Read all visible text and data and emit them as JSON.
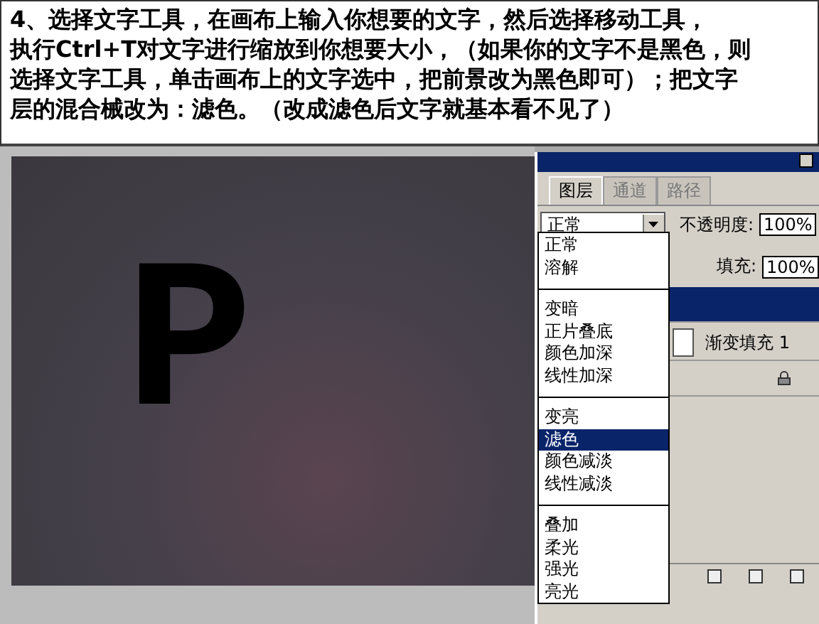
{
  "instructions": {
    "lines": [
      "4、选择文字工具，在画布上输入你想要的文字，然后选择移动工具，",
      "执行Ctrl+T对文字进行缩放到你想要大小，（如果你的文字不是黑色，则",
      "选择文字工具，单击画布上的文字选中，把前景改为黑色即可）；把文字",
      "层的混合械改为：滤色。（改成滤色后文字就基本看不见了）"
    ]
  },
  "canvas": {
    "text": "P"
  },
  "layers_panel": {
    "tabs": [
      {
        "label": "图层",
        "selected": true
      },
      {
        "label": "通道",
        "selected": false
      },
      {
        "label": "路径",
        "selected": false
      }
    ],
    "blend_mode": "正常",
    "opacity_label": "不透明度:",
    "opacity": "100%",
    "fill_label": "填充:",
    "fill": "100%",
    "layers": [
      {
        "selected": true
      },
      {
        "name": "渐变填充 1",
        "selected": false
      }
    ]
  },
  "blend_menu": {
    "groups": [
      [
        {
          "label": "正常",
          "selected": false
        },
        {
          "label": "溶解",
          "selected": false
        }
      ],
      [
        {
          "label": "变暗",
          "selected": false
        },
        {
          "label": "正片叠底",
          "selected": false
        },
        {
          "label": "颜色加深",
          "selected": false
        },
        {
          "label": "线性加深",
          "selected": false
        }
      ],
      [
        {
          "label": "变亮",
          "selected": false
        },
        {
          "label": "滤色",
          "selected": true
        },
        {
          "label": "颜色减淡",
          "selected": false
        },
        {
          "label": "线性减淡",
          "selected": false
        }
      ],
      [
        {
          "label": "叠加",
          "selected": false
        },
        {
          "label": "柔光",
          "selected": false
        },
        {
          "label": "强光",
          "selected": false
        },
        {
          "label": "亮光",
          "selected": false
        }
      ]
    ]
  }
}
